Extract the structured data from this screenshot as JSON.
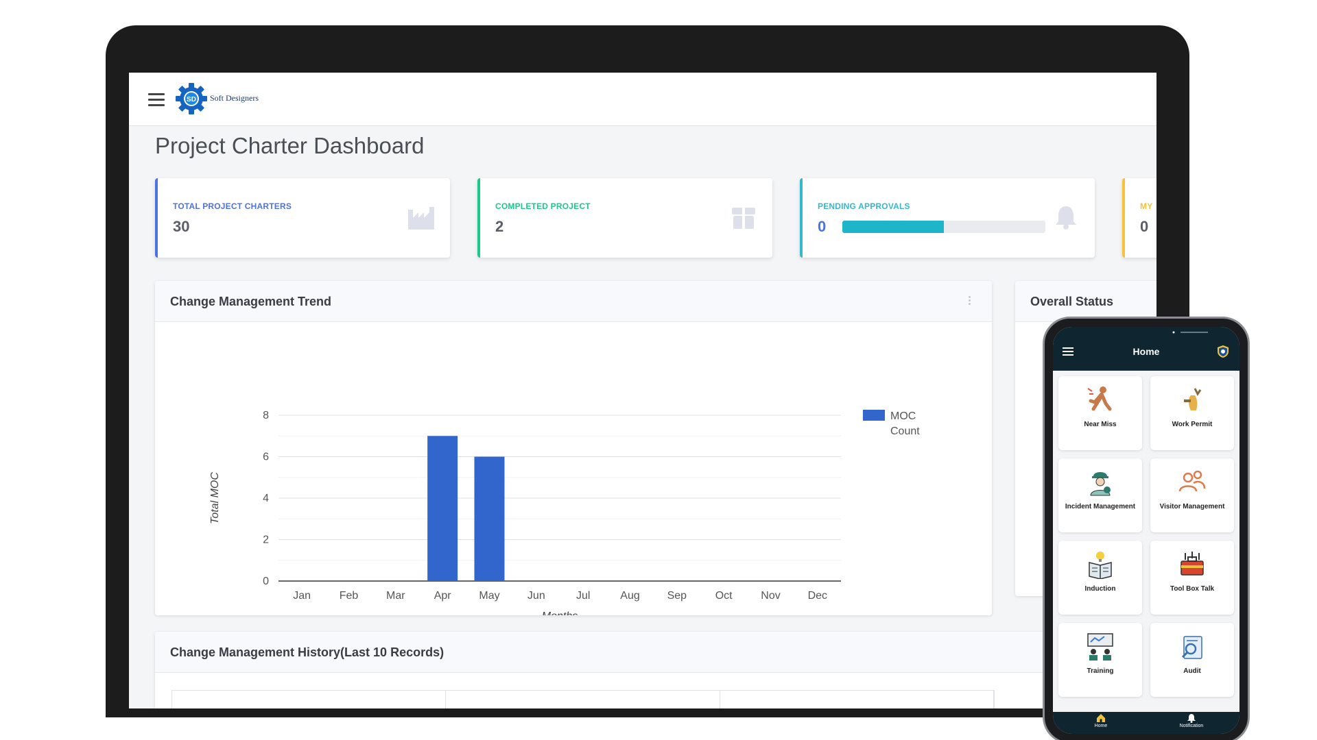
{
  "brand": {
    "name": "Soft Designers",
    "logo_text": "SD"
  },
  "page": {
    "title": "Project Charter Dashboard"
  },
  "cards": [
    {
      "label": "TOTAL PROJECT CHARTERS",
      "value": "30",
      "color": "#4e73df",
      "icon": "factory-icon"
    },
    {
      "label": "COMPLETED PROJECT",
      "value": "2",
      "color": "#1cc88a",
      "icon": "box-icon"
    },
    {
      "label": "PENDING APPROVALS",
      "value": "0",
      "color": "#36b9cc",
      "icon": "bell-icon",
      "progress": 0.5
    },
    {
      "label": "MY",
      "value": "0",
      "color": "#f6c23e"
    }
  ],
  "trend_panel": {
    "title": "Change Management Trend"
  },
  "status_panel": {
    "title": "Overall Status"
  },
  "history_panel": {
    "title": "Change Management History(Last 10 Records)"
  },
  "chart_data": {
    "type": "bar",
    "categories": [
      "Jan",
      "Feb",
      "Mar",
      "Apr",
      "May",
      "Jun",
      "Jul",
      "Aug",
      "Sep",
      "Oct",
      "Nov",
      "Dec"
    ],
    "series": [
      {
        "name": "MOC Count",
        "values": [
          0,
          0,
          0,
          7,
          6,
          0,
          0,
          0,
          0,
          0,
          0,
          0
        ],
        "color": "#3366cc"
      }
    ],
    "xlabel": "Months",
    "ylabel": "Total MOC",
    "ylim": [
      0,
      8
    ],
    "yticks": [
      0,
      2,
      4,
      6,
      8
    ],
    "legend_position": "right",
    "grid": true
  },
  "phone": {
    "title": "Home",
    "tiles": [
      {
        "label": "Near Miss",
        "icon": "near-miss-icon"
      },
      {
        "label": "Work Permit",
        "icon": "work-permit-icon"
      },
      {
        "label": "Incident Management",
        "icon": "incident-management-icon"
      },
      {
        "label": "Visitor Management",
        "icon": "visitor-management-icon"
      },
      {
        "label": "Induction",
        "icon": "induction-icon"
      },
      {
        "label": "Tool Box Talk",
        "icon": "tool-box-talk-icon"
      },
      {
        "label": "Training",
        "icon": "training-icon"
      },
      {
        "label": "Audit",
        "icon": "audit-icon"
      }
    ],
    "nav": [
      {
        "label": "Home",
        "icon": "home-icon"
      },
      {
        "label": "Notification",
        "icon": "notification-bell-icon"
      }
    ]
  }
}
